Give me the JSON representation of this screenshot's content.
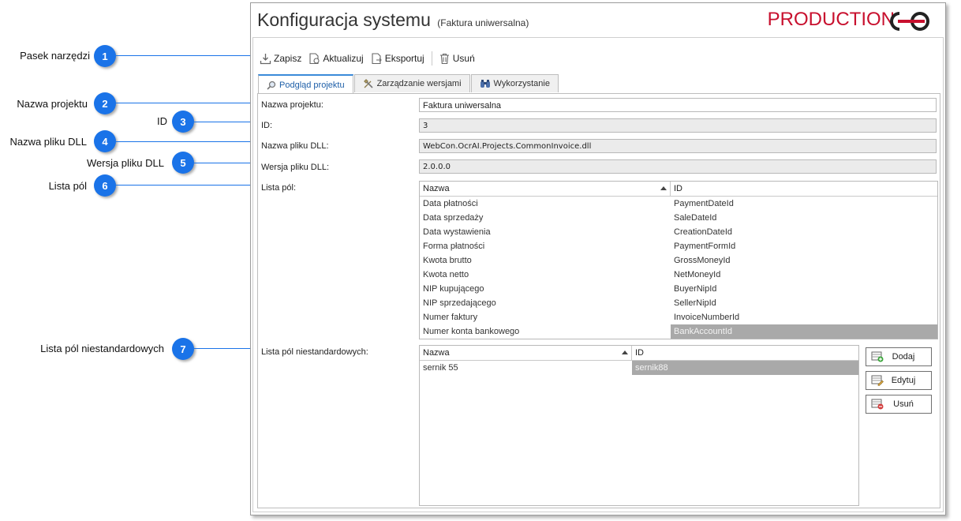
{
  "callouts": [
    {
      "num": "1",
      "label": "Pasek narzędzi"
    },
    {
      "num": "2",
      "label": "Nazwa projektu"
    },
    {
      "num": "3",
      "label": "ID"
    },
    {
      "num": "4",
      "label": "Nazwa pliku DLL"
    },
    {
      "num": "5",
      "label": "Wersja pliku DLL"
    },
    {
      "num": "6",
      "label": "Lista pól"
    },
    {
      "num": "7",
      "label": "Lista pól niestandardowych"
    }
  ],
  "window": {
    "title": "Konfiguracja systemu",
    "subtitle": "(Faktura uniwersalna)",
    "brand": "PRODUCTION",
    "brand_color": "#c8102e",
    "accent_color": "#1a73e8"
  },
  "toolbar": {
    "save": "Zapisz",
    "update": "Aktualizuj",
    "export": "Eksportuj",
    "delete": "Usuń"
  },
  "tabs": [
    {
      "label": "Podgląd projektu",
      "icon": "magnifier-icon",
      "active": true
    },
    {
      "label": "Zarządzanie wersjami",
      "icon": "tools-icon",
      "active": false
    },
    {
      "label": "Wykorzystanie",
      "icon": "binoculars-icon",
      "active": false
    }
  ],
  "form": {
    "project_name_label": "Nazwa projektu:",
    "project_name_value": "Faktura uniwersalna",
    "id_label": "ID:",
    "id_value": "3",
    "dll_name_label": "Nazwa pliku DLL:",
    "dll_name_value": "WebCon.OcrAI.Projects.CommonInvoice.dll",
    "dll_version_label": "Wersja pliku DLL:",
    "dll_version_value": "2.0.0.0",
    "fields_label": "Lista pól:",
    "custom_fields_label": "Lista pól niestandardowych:"
  },
  "fields_grid": {
    "columns": [
      "Nazwa",
      "ID"
    ],
    "rows": [
      [
        "Data płatności",
        "PaymentDateId"
      ],
      [
        "Data sprzedaży",
        "SaleDateId"
      ],
      [
        "Data wystawienia",
        "CreationDateId"
      ],
      [
        "Forma płatności",
        "PaymentFormId"
      ],
      [
        "Kwota brutto",
        "GrossMoneyId"
      ],
      [
        "Kwota netto",
        "NetMoneyId"
      ],
      [
        "NIP kupującego",
        "BuyerNipId"
      ],
      [
        "NIP sprzedającego",
        "SellerNipId"
      ],
      [
        "Numer faktury",
        "InvoiceNumberId"
      ],
      [
        "Numer konta bankowego",
        "BankAccountId"
      ]
    ]
  },
  "custom_grid": {
    "columns": [
      "Nazwa",
      "ID"
    ],
    "rows": [
      [
        "sernik 55",
        "sernik88"
      ]
    ]
  },
  "side_buttons": {
    "add": "Dodaj",
    "edit": "Edytuj",
    "remove": "Usuń"
  }
}
